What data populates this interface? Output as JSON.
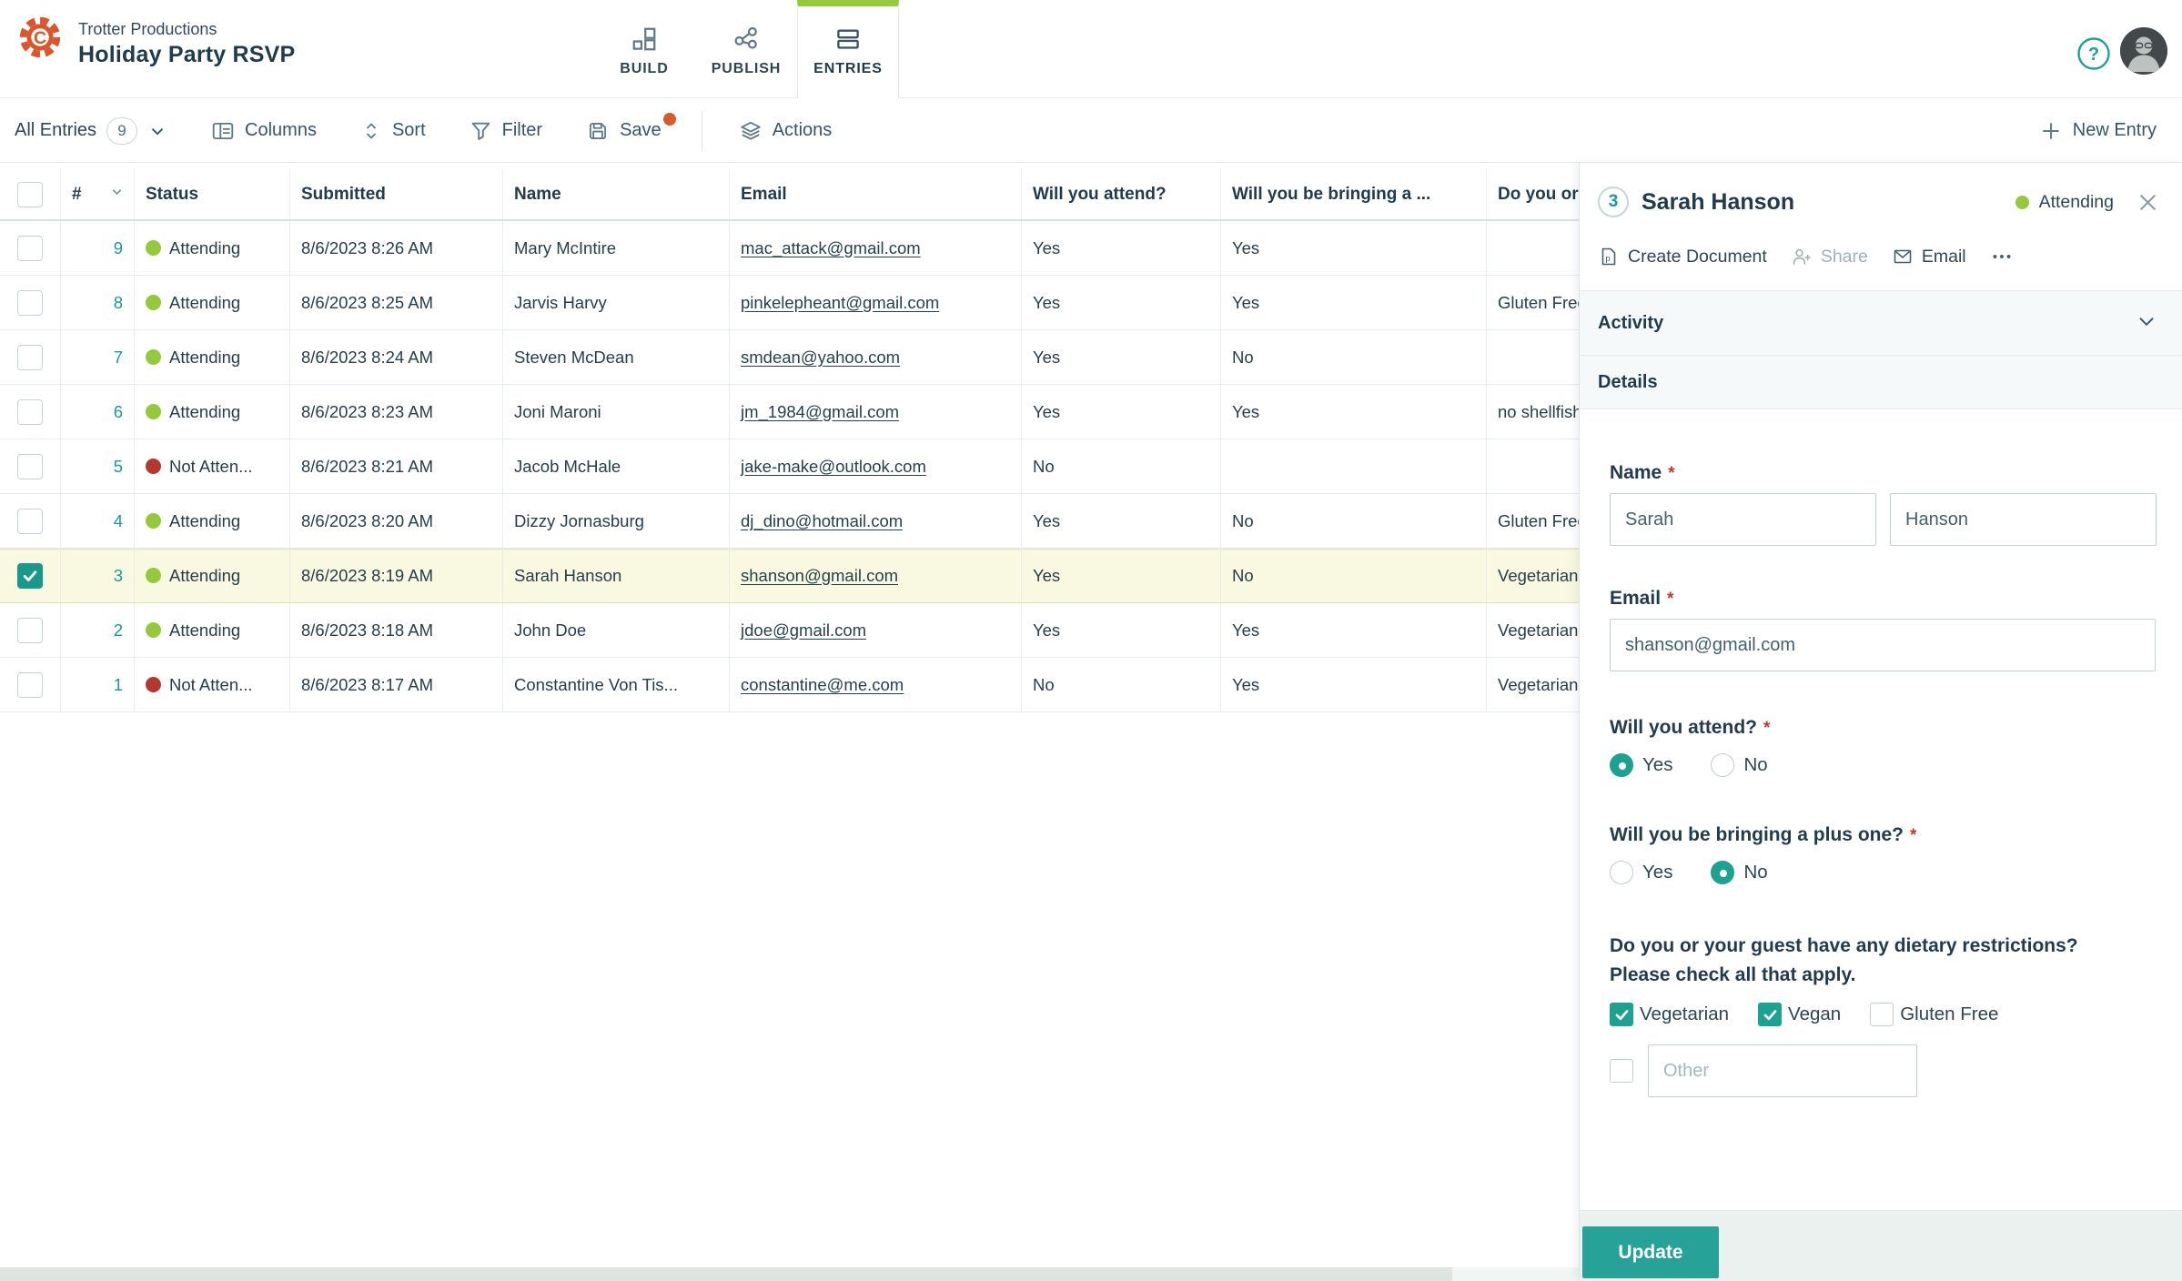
{
  "app": {
    "org_name": "Trotter Productions",
    "form_title": "Holiday Party RSVP",
    "tabs": [
      {
        "label": "BUILD",
        "active": false
      },
      {
        "label": "PUBLISH",
        "active": false
      },
      {
        "label": "ENTRIES",
        "active": true
      }
    ]
  },
  "toolbar": {
    "view_label": "All Entries",
    "view_count": "9",
    "columns": "Columns",
    "sort": "Sort",
    "filter": "Filter",
    "save": "Save",
    "save_has_unsaved_dot": true,
    "actions": "Actions",
    "new_entry": "New Entry"
  },
  "table": {
    "columns": {
      "num": "#",
      "status": "Status",
      "submitted": "Submitted",
      "name": "Name",
      "email": "Email",
      "attend": "Will you attend?",
      "plus_one": "Will you be bringing a ...",
      "dietary": "Do you or your guest have any dietary restrictions?"
    },
    "rows": [
      {
        "num": "9",
        "status_label": "Attending",
        "status_key": "attending",
        "submitted": "8/6/2023 8:26 AM",
        "name": "Mary McIntire",
        "email": "mac_attack@gmail.com",
        "attend": "Yes",
        "plus_one": "Yes",
        "dietary": "",
        "selected": false
      },
      {
        "num": "8",
        "status_label": "Attending",
        "status_key": "attending",
        "submitted": "8/6/2023 8:25 AM",
        "name": "Jarvis Harvy",
        "email": "pinkelepheant@gmail.com",
        "attend": "Yes",
        "plus_one": "Yes",
        "dietary": "Gluten Free",
        "selected": false
      },
      {
        "num": "7",
        "status_label": "Attending",
        "status_key": "attending",
        "submitted": "8/6/2023 8:24 AM",
        "name": "Steven McDean",
        "email": "smdean@yahoo.com",
        "attend": "Yes",
        "plus_one": "No",
        "dietary": "",
        "selected": false
      },
      {
        "num": "6",
        "status_label": "Attending",
        "status_key": "attending",
        "submitted": "8/6/2023 8:23 AM",
        "name": "Joni Maroni",
        "email": "jm_1984@gmail.com",
        "attend": "Yes",
        "plus_one": "Yes",
        "dietary": "no shellfish",
        "selected": false
      },
      {
        "num": "5",
        "status_label": "Not Atten...",
        "status_key": "not-attending",
        "submitted": "8/6/2023 8:21 AM",
        "name": "Jacob McHale",
        "email": "jake-make@outlook.com",
        "attend": "No",
        "plus_one": "",
        "dietary": "",
        "selected": false
      },
      {
        "num": "4",
        "status_label": "Attending",
        "status_key": "attending",
        "submitted": "8/6/2023 8:20 AM",
        "name": "Dizzy Jornasburg",
        "email": "dj_dino@hotmail.com",
        "attend": "Yes",
        "plus_one": "No",
        "dietary": "Gluten Free",
        "selected": false
      },
      {
        "num": "3",
        "status_label": "Attending",
        "status_key": "attending",
        "submitted": "8/6/2023 8:19 AM",
        "name": "Sarah Hanson",
        "email": "shanson@gmail.com",
        "attend": "Yes",
        "plus_one": "No",
        "dietary": "Vegetarian, Vegan",
        "selected": true
      },
      {
        "num": "2",
        "status_label": "Attending",
        "status_key": "attending",
        "submitted": "8/6/2023 8:18 AM",
        "name": "John Doe",
        "email": "jdoe@gmail.com",
        "attend": "Yes",
        "plus_one": "Yes",
        "dietary": "Vegetarian",
        "selected": false
      },
      {
        "num": "1",
        "status_label": "Not Atten...",
        "status_key": "not-attending",
        "submitted": "8/6/2023 8:17 AM",
        "name": "Constantine Von Tis...",
        "email": "constantine@me.com",
        "attend": "No",
        "plus_one": "Yes",
        "dietary": "Vegetarian",
        "selected": false
      }
    ]
  },
  "panel": {
    "entry_number": "3",
    "entry_name": "Sarah Hanson",
    "status_label": "Attending",
    "actions": {
      "create_document": "Create Document",
      "share": "Share",
      "email": "Email"
    },
    "sections": {
      "activity": "Activity",
      "details": "Details"
    },
    "form": {
      "required_mark": "*",
      "name": {
        "label": "Name",
        "first": "Sarah",
        "last": "Hanson"
      },
      "email": {
        "label": "Email",
        "value": "shanson@gmail.com"
      },
      "attend": {
        "label": "Will you attend?",
        "options": [
          "Yes",
          "No"
        ],
        "value": "Yes"
      },
      "plus_one": {
        "label": "Will you be bringing a plus one?",
        "options": [
          "Yes",
          "No"
        ],
        "value": "No"
      },
      "dietary": {
        "label_line1": "Do you or your guest have any dietary restrictions?",
        "label_line2": "Please check all that apply.",
        "options": [
          {
            "label": "Vegetarian",
            "checked": true
          },
          {
            "label": "Vegan",
            "checked": true
          },
          {
            "label": "Gluten Free",
            "checked": false
          }
        ],
        "other": {
          "checked": false,
          "placeholder": "Other",
          "value": ""
        }
      },
      "update_button": "Update"
    }
  },
  "colors": {
    "accent_teal": "#1FA191",
    "brand_orange": "#D9572B",
    "tab_active_green": "#97C93C",
    "status_attending": "#94C83D",
    "status_not_attending": "#B5372E",
    "selected_row_bg": "#F8F9E0",
    "required_asterisk": "#C0392B"
  },
  "icons": {
    "logo": "gear-c-logo",
    "help": "question-circle",
    "build_tab": "blocks",
    "publish_tab": "share-nodes",
    "entries_tab": "stacked-rows",
    "toolbar": [
      "chevron-down",
      "columns-table",
      "sort-arrows",
      "filter-funnel",
      "save-floppy",
      "layers",
      "plus"
    ],
    "panel": [
      "document-page",
      "person-plus",
      "envelope",
      "ellipsis",
      "close-x",
      "chevron-down"
    ]
  }
}
